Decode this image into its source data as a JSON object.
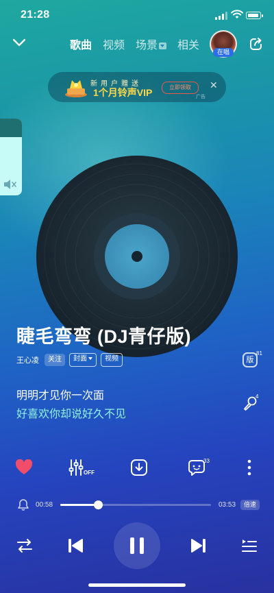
{
  "status_bar": {
    "time": "21:28"
  },
  "nav": {
    "tabs": [
      {
        "label": "歌曲",
        "active": true
      },
      {
        "label": "视频",
        "active": false
      },
      {
        "label": "场景",
        "active": false
      },
      {
        "label": "相关",
        "active": false
      }
    ],
    "avatar_badge": "在唱"
  },
  "ad": {
    "top_line": "新用户赠送",
    "main": "1个月铃声VIP",
    "button": "立即领取",
    "tag": "广告",
    "close": "✕"
  },
  "song": {
    "title": "睫毛弯弯 (DJ青仔版)",
    "artist": "王心凌",
    "follow": "关注",
    "cover": "封面",
    "video": "视频",
    "version_label": "版",
    "version_count": "81",
    "mic_count": "4"
  },
  "lyrics": {
    "current": "明明才见你一次面",
    "next": "好喜欢你却说好久不见"
  },
  "actions": {
    "eq_label": "OFF",
    "comment_count": "33"
  },
  "progress": {
    "current": "00:58",
    "total": "03:53",
    "fraction": 0.249,
    "speed": "倍速"
  },
  "colors": {
    "accent_lyric": "#8ef3e6",
    "heart": "#f04d6a",
    "bg_top": "#1ea8a0",
    "bg_bottom": "#28319f"
  }
}
